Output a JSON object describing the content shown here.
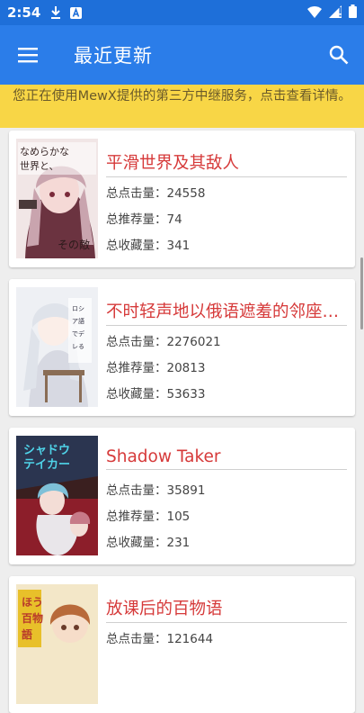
{
  "status": {
    "time": "2:54"
  },
  "app_bar": {
    "title": "最近更新"
  },
  "banner": {
    "text": "您正在使用MewX提供的第三方中继服务，点击查看详情。"
  },
  "labels": {
    "clicks": "总点击量：",
    "recommends": "总推荐量：",
    "favorites": "总收藏量："
  },
  "novels": [
    {
      "title": "平滑世界及其敌人",
      "clicks": "24558",
      "recommends": "74",
      "favorites": "341",
      "cover_text": "なめらかな世界と、その敵"
    },
    {
      "title": "不时轻声地以俄语遮羞的邻座艾莉同学",
      "clicks": "2276021",
      "recommends": "20813",
      "favorites": "53633",
      "cover_text": "時々ボソッとロシア語でデレる隣のアーリャさん"
    },
    {
      "title": "Shadow Taker",
      "clicks": "35891",
      "recommends": "105",
      "favorites": "231",
      "cover_text": "シャドウテイカー"
    },
    {
      "title": "放课后的百物语",
      "clicks": "121644",
      "recommends": "",
      "favorites": "",
      "cover_text": "ほうかご百物語"
    }
  ],
  "colors": {
    "app_bar": "#2b7de9",
    "status_bar": "#1e6fd9",
    "banner": "#f8d646",
    "title_red": "#d63a3a"
  }
}
